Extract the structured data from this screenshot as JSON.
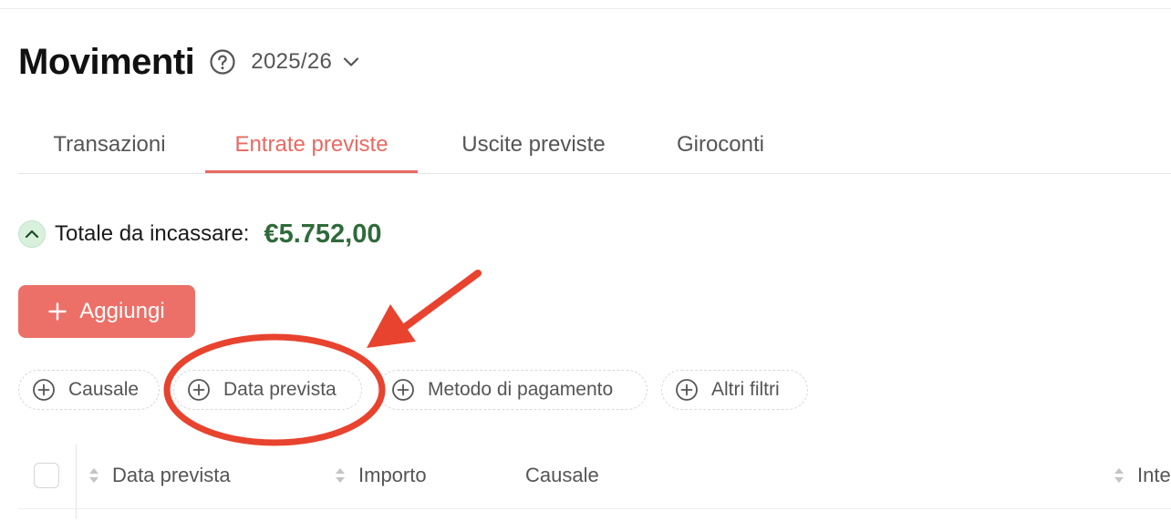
{
  "header": {
    "title": "Movimenti",
    "help_icon": "question-circle-icon",
    "year": "2025/26",
    "year_icon": "chevron-down-icon"
  },
  "tabs": [
    {
      "label": "Transazioni",
      "active": false
    },
    {
      "label": "Entrate previste",
      "active": true
    },
    {
      "label": "Uscite previste",
      "active": false
    },
    {
      "label": "Giroconti",
      "active": false
    }
  ],
  "totals": {
    "label": "Totale da incassare:",
    "value": "€5.752,00",
    "toggle_icon": "chevron-up-icon"
  },
  "actions": {
    "add_label": "Aggiungi",
    "add_icon": "plus-icon"
  },
  "filters": [
    {
      "label": "Causale",
      "icon": "plus-circle-icon"
    },
    {
      "label": "Data prevista",
      "icon": "plus-circle-icon"
    },
    {
      "label": "Metodo di pagamento",
      "icon": "plus-circle-icon"
    },
    {
      "label": "Altri filtri",
      "icon": "plus-circle-icon"
    }
  ],
  "table": {
    "columns": [
      {
        "label": "Data prevista",
        "sortable": true
      },
      {
        "label": "Importo",
        "sortable": true
      },
      {
        "label": "Causale",
        "sortable": false
      },
      {
        "label": "Inte",
        "sortable": true
      }
    ]
  },
  "colors": {
    "accent": "#ec7068",
    "active_tab": "#e86a62",
    "total_green": "#2f6b3a",
    "annotation_red": "#e8432e"
  }
}
